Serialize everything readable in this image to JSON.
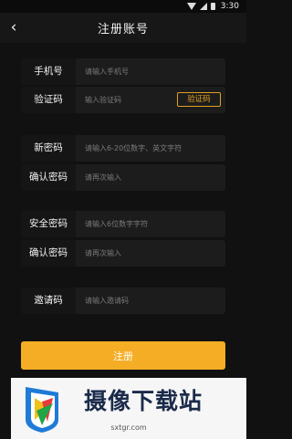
{
  "statusbar": {
    "time": "3:30"
  },
  "header": {
    "title": "注册账号",
    "back_icon": "‹"
  },
  "fields": [
    {
      "label": "手机号",
      "placeholder": "请输入手机号"
    },
    {
      "label": "验证码",
      "placeholder": "输入验证码",
      "button": "验证码"
    },
    {
      "label": "新密码",
      "placeholder": "请输入6-20位数字、英文字符"
    },
    {
      "label": "确认密码",
      "placeholder": "请再次输入"
    },
    {
      "label": "安全密码",
      "placeholder": "请输入6位数字字符"
    },
    {
      "label": "确认密码",
      "placeholder": "请再次输入"
    },
    {
      "label": "邀请码",
      "placeholder": "请输入邀请码"
    }
  ],
  "register_label": "注册",
  "watermark": {
    "title": "摄像下载站",
    "url": "sxtgr.com"
  },
  "colors": {
    "accent": "#f4ad25",
    "background": "#111111",
    "row": "#1c1c1c"
  }
}
